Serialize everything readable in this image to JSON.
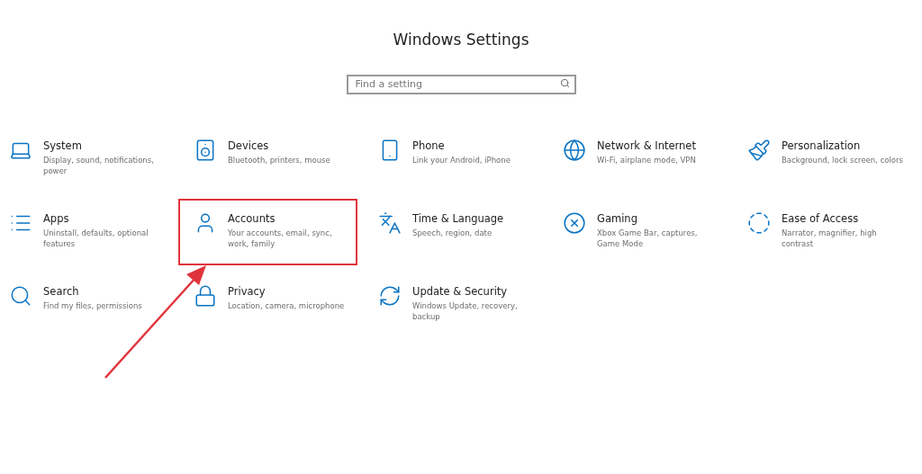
{
  "window": {
    "title": "Windows Settings"
  },
  "search": {
    "placeholder": "Find a setting"
  },
  "categories": [
    {
      "title": "System",
      "description": "Display, sound, notifications, power",
      "highlighted": false
    },
    {
      "title": "Devices",
      "description": "Bluetooth, printers, mouse",
      "highlighted": false
    },
    {
      "title": "Phone",
      "description": "Link your Android, iPhone",
      "highlighted": false
    },
    {
      "title": "Network & Internet",
      "description": "Wi-Fi, airplane mode, VPN",
      "highlighted": false
    },
    {
      "title": "Personalization",
      "description": "Background, lock screen, colors",
      "highlighted": false
    },
    {
      "title": "Apps",
      "description": "Uninstall, defaults, optional features",
      "highlighted": false
    },
    {
      "title": "Accounts",
      "description": "Your accounts, email, sync, work, family",
      "highlighted": true
    },
    {
      "title": "Time & Language",
      "description": "Speech, region, date",
      "highlighted": false
    },
    {
      "title": "Gaming",
      "description": "Xbox Game Bar, captures, Game Mode",
      "highlighted": false
    },
    {
      "title": "Ease of Access",
      "description": "Narrator, magnifier, high contrast",
      "highlighted": false
    },
    {
      "title": "Search",
      "description": "Find my files, permissions",
      "highlighted": false
    },
    {
      "title": "Privacy",
      "description": "Location, camera, microphone",
      "highlighted": false
    },
    {
      "title": "Update & Security",
      "description": "Windows Update, recovery, backup",
      "highlighted": false
    }
  ]
}
